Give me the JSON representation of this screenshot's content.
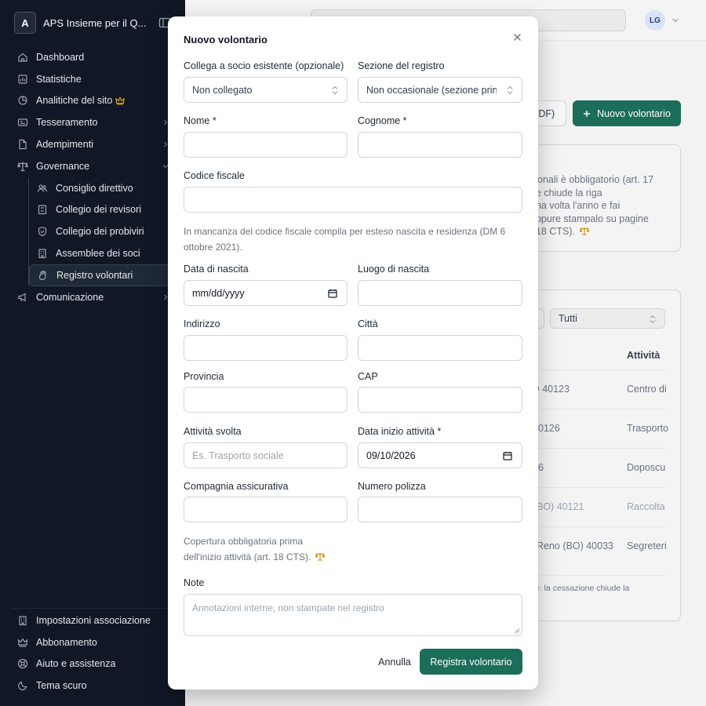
{
  "sidebar": {
    "org_initial": "A",
    "org_name": "APS Insieme per il Q...",
    "nav": [
      {
        "label": "Dashboard",
        "icon": "home-icon"
      },
      {
        "label": "Statistiche",
        "icon": "chart-icon"
      },
      {
        "label": "Analitiche del sito",
        "icon": "analytics-icon",
        "badge_icon": "crown-icon"
      },
      {
        "label": "Tesseramento",
        "icon": "card-icon"
      },
      {
        "label": "Adempimenti",
        "icon": "document-icon"
      },
      {
        "label": "Governance",
        "icon": "scale-icon"
      }
    ],
    "governance_items": [
      {
        "label": "Consiglio direttivo",
        "icon": "users-icon"
      },
      {
        "label": "Collegio dei revisori",
        "icon": "clipboard-icon"
      },
      {
        "label": "Collegio dei probiviri",
        "icon": "shield-icon"
      },
      {
        "label": "Assemblee dei soci",
        "icon": "building-icon"
      },
      {
        "label": "Registro volontari",
        "icon": "hand-icon",
        "active": true
      }
    ],
    "comunicazione": "Comunicazione",
    "bottom": [
      {
        "label": "Impostazioni associazione",
        "icon": "building-icon"
      },
      {
        "label": "Abbonamento",
        "icon": "crown-icon"
      },
      {
        "label": "Aiuto e assistenza",
        "icon": "help-icon"
      },
      {
        "label": "Tema scuro",
        "icon": "moon-icon"
      }
    ]
  },
  "header": {
    "avatar": "LG"
  },
  "page": {
    "pdf_button": "PDF)",
    "new_button": "Nuovo volontario",
    "notice_lines": [
      "sionali è obbligatorio (art. 17",
      "ne chiude la riga",
      "una volta l'anno e fai",
      "oppure stampalo su pagine",
      ". 18 CTS)."
    ],
    "filter_value": "Tutti",
    "column_header": "Attività",
    "rows": [
      {
        "place": "O 40123",
        "activity": "Centro di"
      },
      {
        "place": "0126",
        "activity": "Trasporto"
      },
      {
        "place": "6",
        "activity": "Doposcu"
      },
      {
        "place": "BO) 40121",
        "activity": "Raccolta"
      },
      {
        "place": "Reno (BO) 40033",
        "activity": "Segreteri"
      }
    ],
    "footnote": "e: la cessazione chiude la"
  },
  "modal": {
    "title": "Nuovo volontario",
    "fields": {
      "socio_label": "Collega a socio esistente (opzionale)",
      "socio_value": "Non collegato",
      "sezione_label": "Sezione del registro",
      "sezione_value": "Non occasionale (sezione principale)",
      "nome_label": "Nome *",
      "cognome_label": "Cognome *",
      "cf_label": "Codice fiscale",
      "cf_help": "In mancanza del codice fiscale compila per esteso nascita e residenza (DM 6 ottobre 2021).",
      "data_nascita_label": "Data di nascita",
      "data_nascita_placeholder": "mm/dd/yyyy",
      "luogo_label": "Luogo di nascita",
      "indirizzo_label": "Indirizzo",
      "citta_label": "Città",
      "provincia_label": "Provincia",
      "cap_label": "CAP",
      "attivita_label": "Attività svolta",
      "attivita_placeholder": "Es. Trasporto sociale",
      "inizio_label": "Data inizio attività *",
      "inizio_value": "09/10/2026",
      "compagnia_label": "Compagnia assicurativa",
      "polizza_label": "Numero polizza",
      "copertura_help_1": "Copertura obbligatoria prima",
      "copertura_help_2": "dell'inizio attività (art. 18 CTS).",
      "note_label": "Note",
      "note_placeholder": "Annotazioni interne, non stampate nel registro"
    },
    "cancel": "Annulla",
    "submit": "Registra volontario"
  }
}
